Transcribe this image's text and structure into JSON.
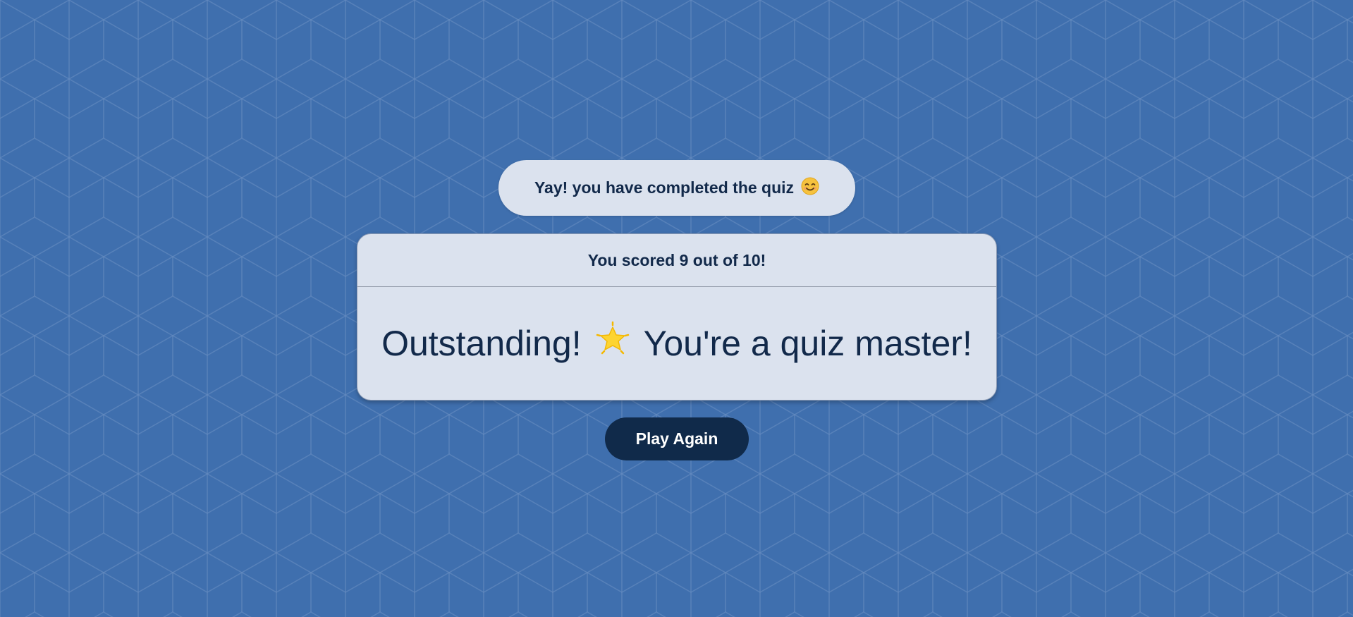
{
  "banner": {
    "text": "Yay! you have completed the quiz",
    "emoji_icon": "smiling-face-icon"
  },
  "result_card": {
    "score_text": "You scored 9 out of 10!",
    "message_before": "Outstanding!",
    "message_icon": "glowing-star-icon",
    "message_after": "You're a quiz master!"
  },
  "actions": {
    "play_again_label": "Play Again"
  },
  "colors": {
    "background": "#3f6fae",
    "card_background": "#dbe2ee",
    "text_dark": "#12294a",
    "button_background": "#102a4a",
    "button_text": "#ffffff"
  }
}
